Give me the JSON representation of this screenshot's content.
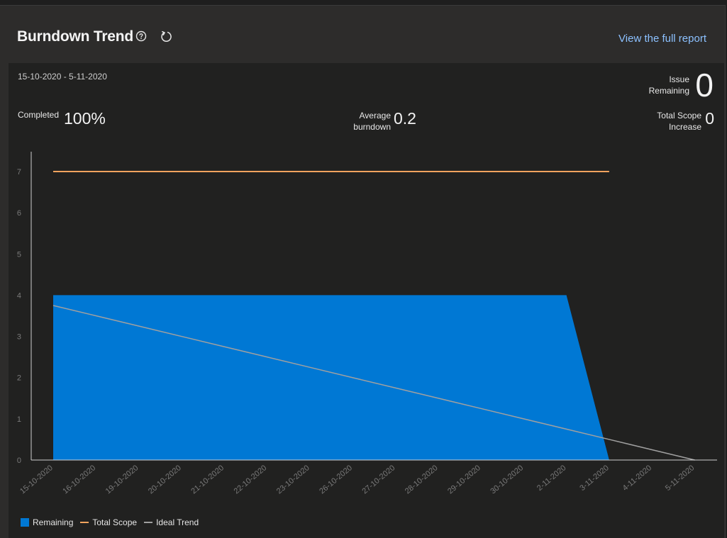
{
  "header": {
    "title": "Burndown Trend",
    "full_report_label": "View the full report"
  },
  "icons": {
    "help": "help-circle-icon",
    "refresh": "refresh-icon"
  },
  "summary": {
    "date_range": "15-10-2020 - 5-11-2020",
    "issue_remaining": {
      "label_line1": "Issue",
      "label_line2": "Remaining",
      "value": "0"
    },
    "completed": {
      "label": "Completed",
      "value": "100%"
    },
    "average_burndown": {
      "label_line1": "Average",
      "label_line2": "burndown",
      "value": "0.2"
    },
    "total_scope_increase": {
      "label_line1": "Total Scope",
      "label_line2": "Increase",
      "value": "0"
    }
  },
  "colors": {
    "remaining": "#0078d4",
    "total_scope": "#f2a35e",
    "ideal_trend": "#a0a0a0",
    "axis": "#d0d0d0"
  },
  "chart_data": {
    "type": "area",
    "categories": [
      "15-10-2020",
      "16-10-2020",
      "19-10-2020",
      "20-10-2020",
      "21-10-2020",
      "22-10-2020",
      "23-10-2020",
      "26-10-2020",
      "27-10-2020",
      "28-10-2020",
      "29-10-2020",
      "30-10-2020",
      "2-11-2020",
      "3-11-2020",
      "4-11-2020",
      "5-11-2020"
    ],
    "ylim": [
      0,
      7
    ],
    "yticks": [
      0,
      1,
      2,
      3,
      4,
      5,
      6,
      7
    ],
    "series": [
      {
        "name": "Remaining",
        "kind": "area",
        "values": [
          4,
          4,
          4,
          4,
          4,
          4,
          4,
          4,
          4,
          4,
          4,
          4,
          4,
          0,
          null,
          null
        ]
      },
      {
        "name": "Total Scope",
        "kind": "line",
        "values": [
          7,
          7,
          7,
          7,
          7,
          7,
          7,
          7,
          7,
          7,
          7,
          7,
          7,
          7,
          null,
          null
        ]
      },
      {
        "name": "Ideal Trend",
        "kind": "line",
        "values": [
          3.75,
          3.5,
          3.25,
          3,
          2.75,
          2.5,
          2.25,
          2,
          1.75,
          1.5,
          1.25,
          1,
          0.75,
          0.5,
          0.25,
          0
        ]
      }
    ],
    "legend": "bottom-left"
  }
}
